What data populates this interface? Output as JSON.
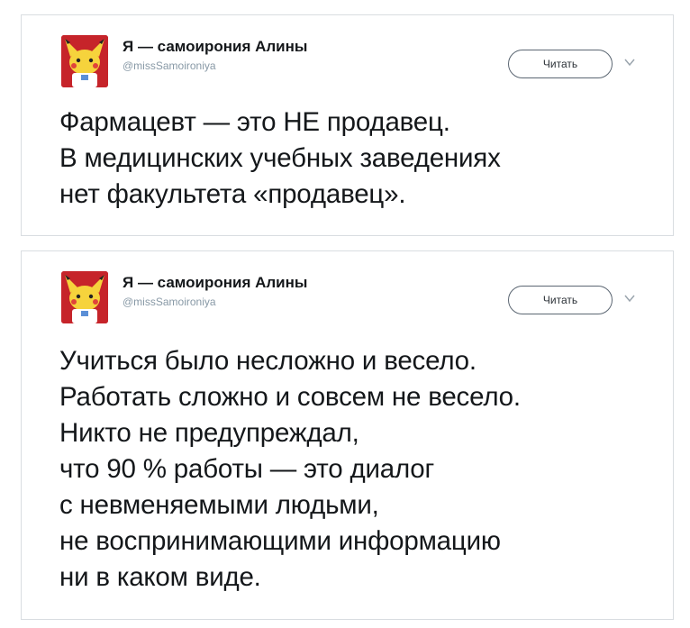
{
  "tweets": [
    {
      "author_name": "Я — самоирония Алины",
      "author_handle": "@missSamoironiya",
      "follow_label": "Читать",
      "avatar_icon": "pikachu-avatar",
      "text": "Фармацевт — это НЕ продавец.\nВ медицинских учебных заведениях\nнет факультета «продавец»."
    },
    {
      "author_name": "Я — самоирония Алины",
      "author_handle": "@missSamoironiya",
      "follow_label": "Читать",
      "avatar_icon": "pikachu-avatar",
      "text": "Учиться было несложно и весело.\nРаботать сложно и совсем не весело.\nНикто не предупреждал,\nчто 90 % работы — это диалог\nс невменяемыми людьми,\nне воспринимающими информацию\nни в каком виде."
    }
  ],
  "colors": {
    "avatar_background": "#c6242a",
    "pikachu_yellow": "#f6d33c",
    "text": "#14171a",
    "handle": "#8899a6",
    "card_border": "#d9dde1"
  }
}
